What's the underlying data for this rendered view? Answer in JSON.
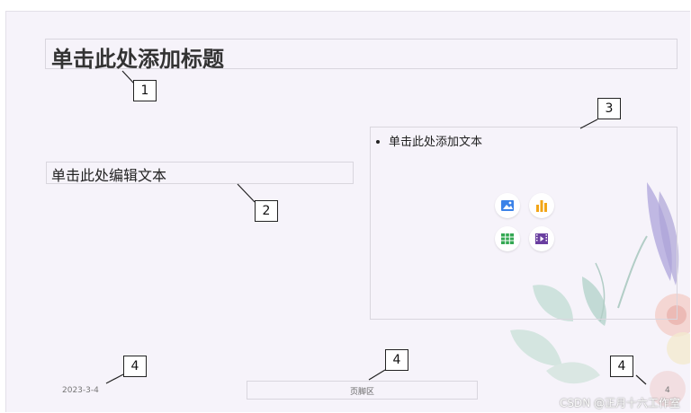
{
  "slide": {
    "title_placeholder": "单击此处添加标题",
    "subtitle_placeholder": "单击此处编辑文本",
    "content_bullet": "单击此处添加文本",
    "footer": {
      "date": "2023-3-4",
      "text": "页脚区",
      "page_number": "4"
    },
    "insert_icons": [
      "image-icon",
      "chart-icon",
      "table-icon",
      "video-icon"
    ]
  },
  "callouts": [
    "1",
    "2",
    "3",
    "4",
    "4",
    "4"
  ],
  "watermark": "CSDN @正月十六工作室",
  "colors": {
    "slide_background": "#f6f3fa",
    "placeholder_border": "#d9d6de",
    "image_icon": "#3b82e8",
    "chart_icon": "#f2a516",
    "table_icon": "#34a853",
    "video_icon": "#6a3fa0"
  }
}
